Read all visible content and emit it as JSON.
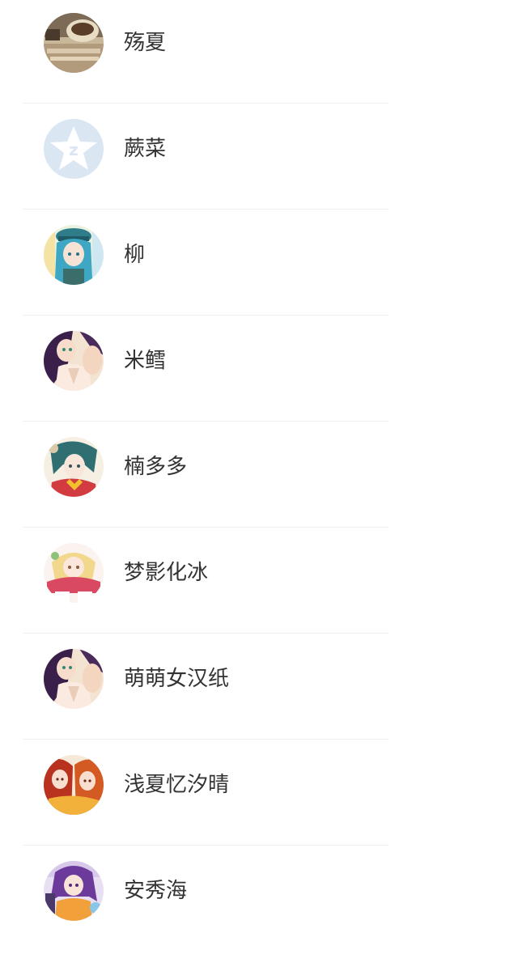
{
  "contacts": [
    {
      "name": "殇夏",
      "avatar": "coffee-photo-avatar"
    },
    {
      "name": "蕨菜",
      "avatar": "qzone-default-avatar"
    },
    {
      "name": "柳",
      "avatar": "anime-blue-hair-avatar"
    },
    {
      "name": "米鳕",
      "avatar": "anime-purple-hair-avatar"
    },
    {
      "name": "楠多多",
      "avatar": "anime-teal-hair-avatar"
    },
    {
      "name": "梦影化冰",
      "avatar": "anime-pink-blonde-avatar"
    },
    {
      "name": "萌萌女汉纸",
      "avatar": "anime-purple-hair-avatar"
    },
    {
      "name": "浅夏忆汐晴",
      "avatar": "anime-red-hair-pair-avatar"
    },
    {
      "name": "安秀海",
      "avatar": "anime-purple-pigtails-avatar"
    }
  ]
}
